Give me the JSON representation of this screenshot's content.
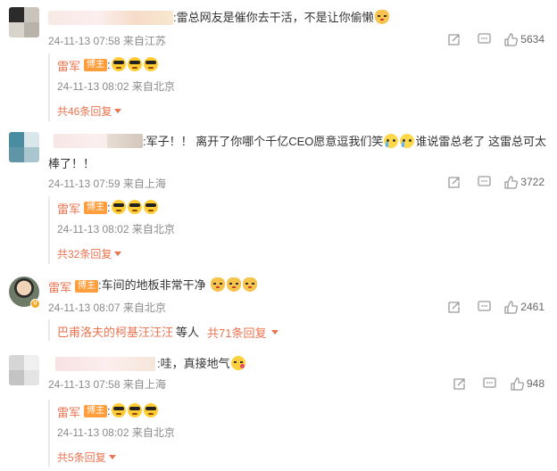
{
  "colors": {
    "accent": "#eb7350",
    "badge": "#ff9e3d",
    "meta": "#8a8a8a"
  },
  "icons": {
    "forward": "forward-icon",
    "comment": "comment-icon",
    "like": "thumbs-up-icon"
  },
  "comments": [
    {
      "text": ":雷总网友是催你去干活，不是让你偷懒",
      "emoji_after": [
        "cat-emoji"
      ],
      "time": "24-11-13 07:58",
      "location": "来自江苏",
      "likes": "5634",
      "reply": {
        "name": "雷军",
        "badge": "博主",
        "text": ":",
        "emojis": [
          "sunglasses-emoji",
          "sunglasses-emoji",
          "sunglasses-emoji"
        ],
        "time": "24-11-13 08:02",
        "location": "来自北京",
        "more": "共46条回复"
      }
    },
    {
      "text_part1": ":军子！！ 离开了你哪个千亿CEO愿意逗我们笑",
      "text_part2": "谁说雷总老了 这雷总可太",
      "text_line2": "棒了！！",
      "time": "24-11-13 07:59",
      "location": "来自上海",
      "likes": "3722",
      "reply": {
        "name": "雷军",
        "badge": "博主",
        "text": ":",
        "time": "24-11-13 08:02",
        "location": "来自北京",
        "more": "共32条回复"
      }
    },
    {
      "name": "雷军",
      "badge": "博主",
      "text": ":车间的地板非常干净",
      "time": "24-11-13 08:07",
      "location": "来自北京",
      "likes": "2461",
      "sub_user": "巴甫洛夫的柯基汪汪汪",
      "sub_text": "等人",
      "more": "共71条回复"
    },
    {
      "text": ":哇，真接地气",
      "time": "24-11-13 07:58",
      "location": "来自上海",
      "likes": "948",
      "reply": {
        "name": "雷军",
        "badge": "博主",
        "text": ":",
        "time": "24-11-13 08:02",
        "location": "来自北京",
        "more": "共5条回复"
      }
    }
  ]
}
